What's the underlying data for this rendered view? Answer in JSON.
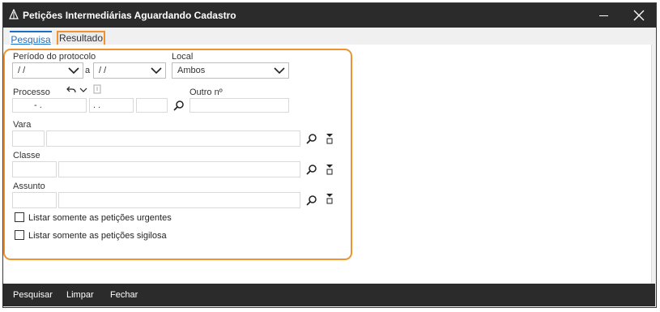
{
  "window": {
    "title": "Petições Intermediárias Aguardando Cadastro",
    "minimize_icon": "minimize-icon",
    "close_icon": "close-icon"
  },
  "tabs": [
    {
      "label": "Pesquisa",
      "active": true
    },
    {
      "label": "Resultado",
      "active": false
    }
  ],
  "form": {
    "periodo_label": "Período do protocolo",
    "periodo_from": "/ /",
    "periodo_sep": "a",
    "periodo_to": "/ /",
    "local_label": "Local",
    "local_value": "Ambos",
    "processo_label": "Processo",
    "processo_part1": "-  .",
    "processo_part2": ".  .",
    "processo_part3": "",
    "outro_label": "Outro nº",
    "outro_value": "",
    "vara_label": "Vara",
    "classe_label": "Classe",
    "assunto_label": "Assunto",
    "checkbox_urgentes": "Listar somente as petições urgentes",
    "checkbox_sigilosas": "Listar somente as petições sigilosa"
  },
  "footer": {
    "pesquisar": "Pesquisar",
    "limpar": "Limpar",
    "fechar": "Fechar"
  },
  "colors": {
    "accent": "#1a6fc4",
    "highlight": "#f0922e",
    "titlebar": "#2b2b2b"
  }
}
